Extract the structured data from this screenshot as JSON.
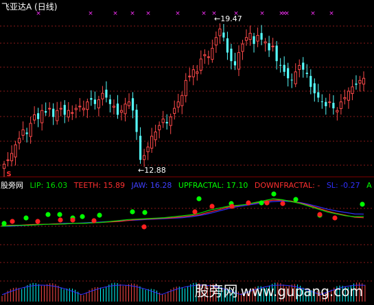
{
  "title": "飞亚达A (日线)",
  "colors": {
    "bg": "#000000",
    "up": "#ff4a4a",
    "down": "#56ffff",
    "grid": "#8b1a1a",
    "lip": "#00e000",
    "teeth": "#ff3030",
    "jaw": "#3030ff",
    "upfractal": "#00ff00",
    "downfractal": "#ff2020",
    "marker": "#ff30ff"
  },
  "price_annotations": {
    "high": "19.47",
    "low": "12.88",
    "signal": "S"
  },
  "indicator": {
    "site": "股旁网",
    "lip": "LIP: 16.03",
    "teeth": "TEETH: 15.89",
    "jaw": "JAW: 16.28",
    "upfractal": "UPFRACTAL: 17.10",
    "downfractal": "DOWNFRACTAL: -",
    "sl": "SL: -0.27",
    "a": "A"
  },
  "watermark": {
    "cn": "股旁网",
    "url": "www.gupang.com"
  },
  "chart_data": {
    "type": "candlestick",
    "y_range": [
      12.6,
      20.2
    ],
    "close": [
      13.0,
      13.2,
      13.5,
      13.9,
      14.2,
      14.6,
      14.4,
      14.9,
      15.3,
      15.1,
      15.5,
      15.4,
      15.6,
      15.2,
      15.5,
      15.6,
      15.3,
      15.5,
      15.4,
      15.6,
      15.7,
      15.6,
      15.9,
      16.0,
      15.8,
      16.0,
      16.3,
      16.1,
      15.8,
      15.7,
      15.3,
      15.5,
      15.8,
      15.9,
      15.5,
      14.5,
      13.2,
      13.4,
      13.8,
      14.3,
      14.5,
      14.8,
      15.1,
      14.9,
      15.2,
      15.6,
      15.9,
      16.2,
      16.9,
      17.1,
      17.4,
      17.3,
      17.9,
      18.1,
      18.0,
      18.4,
      18.9,
      19.3,
      18.9,
      18.2,
      17.8,
      17.6,
      18.2,
      18.6,
      18.9,
      19.1,
      18.6,
      19.0,
      18.8,
      18.7,
      18.3,
      18.5,
      17.8,
      17.6,
      17.3,
      17.0,
      16.9,
      17.3,
      17.6,
      17.4,
      17.2,
      16.6,
      16.3,
      16.1,
      15.9,
      15.7,
      15.9,
      15.6,
      15.5,
      15.9,
      16.1,
      16.4,
      16.6,
      16.7,
      16.9,
      17.0
    ],
    "lip": [
      15.0,
      15.05,
      15.1,
      15.1,
      15.15,
      15.2,
      15.2,
      15.25,
      15.3,
      15.3,
      15.35,
      15.4,
      15.5,
      15.6,
      15.7,
      15.75,
      15.8,
      15.85,
      15.9,
      16.0,
      16.1,
      16.2,
      16.4,
      16.7,
      16.9,
      17.1,
      17.2,
      17.3,
      17.5,
      17.7,
      17.9,
      17.8,
      17.6,
      17.4,
      17.1,
      16.8,
      16.5,
      16.3,
      16.1,
      16.0,
      16.03
    ],
    "teeth": [
      15.05,
      15.1,
      15.1,
      15.15,
      15.2,
      15.2,
      15.25,
      15.25,
      15.3,
      15.3,
      15.35,
      15.4,
      15.45,
      15.5,
      15.6,
      15.7,
      15.75,
      15.8,
      15.85,
      15.9,
      16.0,
      16.1,
      16.25,
      16.5,
      16.75,
      17.0,
      17.15,
      17.3,
      17.45,
      17.6,
      17.75,
      17.75,
      17.65,
      17.45,
      17.2,
      16.9,
      16.6,
      16.35,
      16.15,
      15.95,
      15.89
    ],
    "jaw": [
      15.0,
      15.0,
      15.05,
      15.1,
      15.15,
      15.2,
      15.25,
      15.3,
      15.3,
      15.35,
      15.4,
      15.45,
      15.5,
      15.55,
      15.6,
      15.65,
      15.7,
      15.75,
      15.8,
      15.85,
      15.9,
      16.0,
      16.15,
      16.35,
      16.6,
      16.85,
      17.05,
      17.2,
      17.35,
      17.5,
      17.6,
      17.65,
      17.6,
      17.5,
      17.3,
      17.05,
      16.8,
      16.6,
      16.45,
      16.3,
      16.28
    ]
  }
}
